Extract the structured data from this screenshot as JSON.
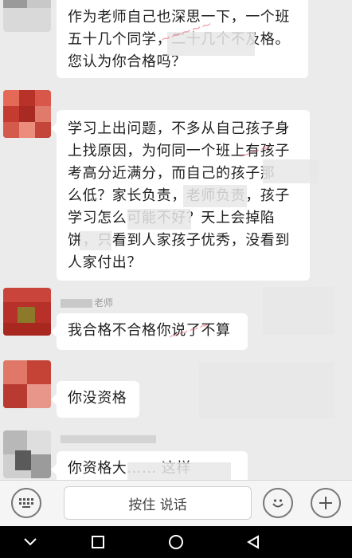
{
  "messages": [
    {
      "lines": [
        "作为老师自己也深思一下，一个班",
        "五十几个同学，二十几个不及格。",
        "您认为你合格吗？"
      ],
      "sender": ""
    },
    {
      "lines": [
        "学习上出问题，不多从自己孩子身",
        "上找原因，为何同一个班上有孩子",
        "考高分近满分，而自己的孩子那",
        "么低？家长负责，老师负责，孩子",
        "学习怎么可能不好？天上会掉陷",
        "饼，只看到人家孩子优秀，没看到",
        "人家付出？"
      ],
      "sender": ""
    },
    {
      "text": "我合格不合格你说了不算",
      "sender": "老师"
    },
    {
      "text": "你没资格",
      "sender": ""
    },
    {
      "text": "你资格大…… 这样",
      "sender": ""
    }
  ],
  "input": {
    "hold_to_talk": "按住 说话"
  },
  "icons": {
    "keyboard": "keyboard-icon",
    "emoji": "emoji-icon",
    "plus": "plus-icon",
    "back": "nav-back-icon",
    "home": "nav-home-icon",
    "recent": "nav-recent-icon",
    "down": "nav-chevron-down-icon"
  },
  "colors": {
    "background": "#ebebeb",
    "bubble": "#ffffff",
    "watermark": "#e65064",
    "navbar": "#000000"
  }
}
